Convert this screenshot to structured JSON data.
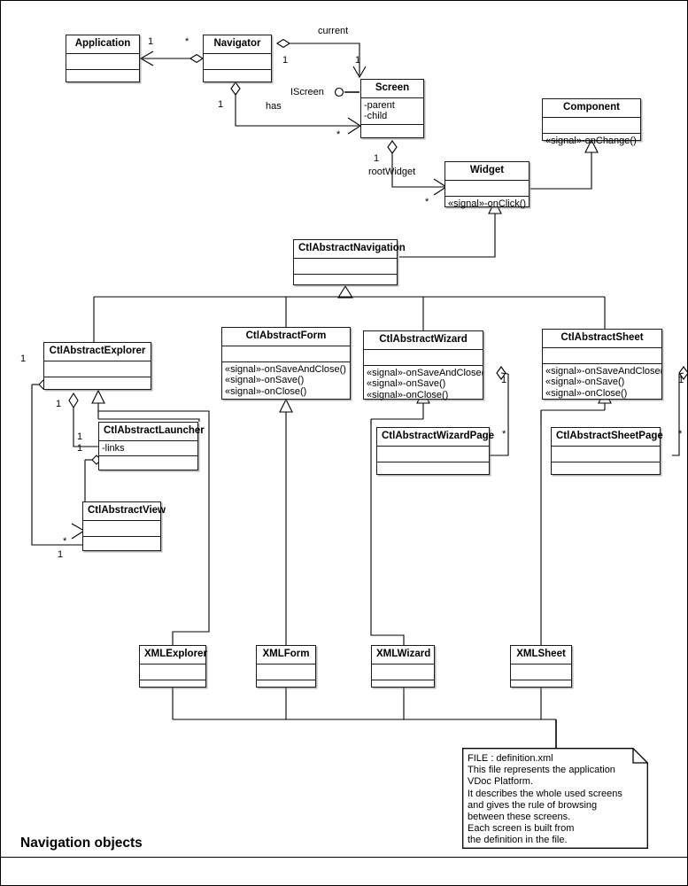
{
  "diagram": {
    "title": "Navigation objects",
    "kind": "UML class diagram"
  },
  "classes": {
    "application": {
      "name": "Application",
      "attrs": [],
      "ops": []
    },
    "navigator": {
      "name": "Navigator",
      "attrs": [],
      "ops": []
    },
    "screen": {
      "name": "Screen",
      "attrs": [
        "-parent",
        "-child"
      ],
      "ops": []
    },
    "component": {
      "name": "Component",
      "attrs": [],
      "ops": [
        "«signal»-onChange()"
      ]
    },
    "widget": {
      "name": "Widget",
      "attrs": [],
      "ops": [
        "«signal»-onClick()"
      ]
    },
    "ctl_navigation": {
      "name": "CtlAbstractNavigation",
      "attrs": [],
      "ops": []
    },
    "ctl_explorer": {
      "name": "CtlAbstractExplorer",
      "attrs": [],
      "ops": []
    },
    "ctl_form": {
      "name": "CtlAbstractForm",
      "attrs": [],
      "ops": [
        "«signal»-onSaveAndClose()",
        "«signal»-onSave()",
        "«signal»-onClose()"
      ]
    },
    "ctl_wizard": {
      "name": "CtlAbstractWizard",
      "attrs": [],
      "ops": [
        "«signal»-onSaveAndClose()",
        "«signal»-onSave()",
        "«signal»-onClose()"
      ]
    },
    "ctl_sheet": {
      "name": "CtlAbstractSheet",
      "attrs": [],
      "ops": [
        "«signal»-onSaveAndClose()",
        "«signal»-onSave()",
        "«signal»-onClose()"
      ]
    },
    "ctl_launcher": {
      "name": "CtlAbstractLauncher",
      "attrs": [
        "-links"
      ],
      "ops": []
    },
    "ctl_view": {
      "name": "CtlAbstractView",
      "attrs": [],
      "ops": []
    },
    "ctl_wizard_page": {
      "name": "CtlAbstractWizardPage",
      "attrs": [],
      "ops": []
    },
    "ctl_sheet_page": {
      "name": "CtlAbstractSheetPage",
      "attrs": [],
      "ops": []
    },
    "xml_explorer": {
      "name": "XMLExplorer",
      "attrs": [],
      "ops": []
    },
    "xml_form": {
      "name": "XMLForm",
      "attrs": [],
      "ops": []
    },
    "xml_wizard": {
      "name": "XMLWizard",
      "attrs": [],
      "ops": []
    },
    "xml_sheet": {
      "name": "XMLSheet",
      "attrs": [],
      "ops": []
    }
  },
  "interfaces": {
    "iscreen": {
      "label": "IScreen",
      "provider": "Screen"
    }
  },
  "edge_labels": {
    "current": "current",
    "has": "has",
    "rootwidget": "rootWidget"
  },
  "multiplicities": {
    "app_one": "1",
    "nav_many": "*",
    "nav_current_one": "1",
    "screen_current_one": "1",
    "nav_has_one": "1",
    "screen_has_many": "*",
    "screen_root_one": "1",
    "widget_many": "*",
    "explorer_one_left": "1",
    "explorer_one_diamond": "1",
    "launcher_one_a": "1",
    "launcher_one_b": "1",
    "view_many": "*",
    "view_one": "1",
    "wizard_one": "1",
    "wizardpage_many": "*",
    "sheet_one": "1",
    "sheetpage_many": "*"
  },
  "note": {
    "text": "FILE : definition.xml\nThis file represents the application\nVDoc Platform.\nIt describes the whole used screens\nand gives the rule of browsing\nbetween these screens.\nEach screen is built from\nthe definition in the file."
  },
  "colors": {
    "stroke": "#000000",
    "fill": "#ffffff",
    "shadow": "#787878",
    "background": "#ffffff"
  }
}
